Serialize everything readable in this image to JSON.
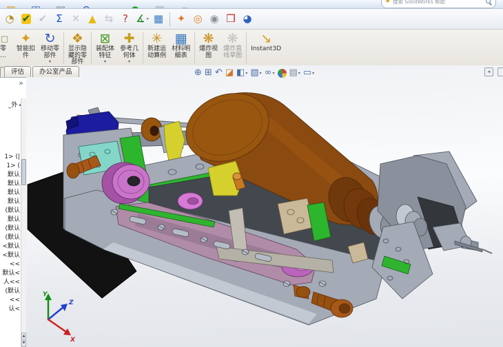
{
  "search": {
    "text": "搜索 SolidWorks 帮助",
    "flag_glyph": "⚑"
  },
  "quick_access": {
    "icons": [
      {
        "name": "open-file",
        "glyph": "▨",
        "color": "#d8a020"
      },
      {
        "name": "save",
        "glyph": "◫",
        "color": "#3060b0"
      },
      {
        "name": "print",
        "glyph": "▤",
        "color": "#708090"
      },
      {
        "name": "undo",
        "glyph": "↶",
        "color": "#3060b0"
      },
      {
        "name": "select",
        "glyph": "▭",
        "color": "#607080"
      },
      {
        "name": "rebuild",
        "glyph": "●",
        "color": "#20a020"
      },
      {
        "name": "file-properties",
        "glyph": "▣",
        "color": "#8898a8"
      },
      {
        "name": "toolbar-options",
        "glyph": "▾",
        "color": "#8898a8"
      }
    ]
  },
  "toolbar": {
    "icons": [
      {
        "name": "timer",
        "glyph": "◔",
        "color": "#b89020"
      },
      {
        "name": "design-checker",
        "glyph": "✔",
        "color": "#1a6a1a",
        "bg": "#f5c518"
      },
      {
        "name": "verification",
        "glyph": "✔",
        "color": "#8a9098",
        "disabled": true
      },
      {
        "name": "equations",
        "glyph": "Σ",
        "color": "#1a50c8"
      },
      {
        "name": "interference-detection",
        "glyph": "✕",
        "color": "#8a9098",
        "disabled": true
      },
      {
        "name": "draft-analysis",
        "glyph": "▲",
        "color": "#e8b810"
      },
      {
        "name": "symmetry-check",
        "glyph": "⇆",
        "color": "#8a9098",
        "disabled": true
      },
      {
        "name": "import-diagnostics",
        "glyph": "?",
        "color": "#c03030"
      },
      {
        "name": "measure",
        "glyph": "∡",
        "color": "#208020",
        "dropdown": true
      },
      {
        "name": "design-table",
        "glyph": "▦",
        "color": "#3878c0"
      },
      {
        "name": "separator"
      },
      {
        "name": "simulationxpress",
        "glyph": "✦",
        "color": "#e07820"
      },
      {
        "name": "floxpress",
        "glyph": "◎",
        "color": "#e08020"
      },
      {
        "name": "dfmxpress",
        "glyph": "◉",
        "color": "#8a9098"
      },
      {
        "name": "driveworksxpress",
        "glyph": "❒",
        "color": "#c02020"
      },
      {
        "name": "edrawings",
        "glyph": "◕",
        "color": "#3060c0"
      }
    ]
  },
  "ribbon": {
    "buttons": [
      {
        "name": "insert-component",
        "lines": [
          "零",
          "…"
        ],
        "clipped": true,
        "glyph": "▫",
        "color": "#b0a890"
      },
      {
        "name": "smart-fasteners",
        "lines": [
          "智能扣",
          "件"
        ],
        "glyph": "✦",
        "color": "#d4a017"
      },
      {
        "name": "move-component",
        "lines": [
          "移动零",
          "部件"
        ],
        "dropdown": true,
        "glyph": "↻",
        "color": "#3060c0",
        "sep_after": true
      },
      {
        "name": "show-hidden-components",
        "lines": [
          "显示隐",
          "藏的零",
          "部件"
        ],
        "dropdown": true,
        "glyph": "❖",
        "color": "#c89018",
        "sep_after": true
      },
      {
        "name": "assembly-features",
        "lines": [
          "装配体",
          "特征"
        ],
        "dropdown": true,
        "glyph": "⊠",
        "color": "#50a030"
      },
      {
        "name": "reference-geometry",
        "lines": [
          "参考几",
          "何体"
        ],
        "dropdown": true,
        "glyph": "✚",
        "color": "#c8a020",
        "sep_after": true
      },
      {
        "name": "new-motion-study",
        "lines": [
          "新建运",
          "动算例"
        ],
        "glyph": "✳",
        "color": "#c89018"
      },
      {
        "name": "bill-of-materials",
        "lines": [
          "材料明",
          "细表"
        ],
        "glyph": "▦",
        "color": "#3878c0",
        "sep_after": true
      },
      {
        "name": "exploded-view",
        "lines": [
          "爆炸视",
          "图"
        ],
        "glyph": "❋",
        "color": "#c89018"
      },
      {
        "name": "explode-line-sketch",
        "lines": [
          "爆炸直",
          "线草图"
        ],
        "disabled": true,
        "glyph": "❋",
        "color": "#909090",
        "sep_after": true
      },
      {
        "name": "instant3d",
        "lines": [
          "Instant3D"
        ],
        "glyph": "↘",
        "color": "#d4a017"
      }
    ]
  },
  "tabs": [
    {
      "name": "evaluate",
      "label": "评估"
    },
    {
      "name": "office-products",
      "label": "办公室产品"
    }
  ],
  "headsup": {
    "icons": [
      {
        "name": "zoom-to-fit",
        "glyph": "⊕",
        "color": "#4a6fa5"
      },
      {
        "name": "zoom-to-area",
        "glyph": "⊞",
        "color": "#4a6fa5"
      },
      {
        "name": "previous-view",
        "glyph": "↶",
        "color": "#4a6fa5"
      },
      {
        "name": "section-view",
        "glyph": "◪",
        "color": "#d07828"
      },
      {
        "name": "view-orientation",
        "glyph": "◧",
        "color": "#4a6fa5",
        "dropdown": true
      },
      {
        "name": "display-style",
        "glyph": "▧",
        "color": "#4a6fa5",
        "dropdown": true
      },
      {
        "name": "hide-show-items",
        "glyph": "∞",
        "color": "#4a6fa5",
        "dropdown": true
      },
      {
        "name": "edit-appearance",
        "ball": true
      },
      {
        "name": "apply-scene",
        "glyph": "▤",
        "color": "#7a88a0",
        "dropdown": true
      },
      {
        "name": "view-settings",
        "glyph": "▭",
        "color": "#4a6fa5",
        "dropdown": true
      }
    ]
  },
  "taskpane": {
    "collapse_glyph": "◂"
  },
  "sidebar": {
    "flyout_glyph": "»",
    "root_label": "_外",
    "root_caret": "▴",
    "items": [
      "1> (|",
      "1> (",
      "默认",
      "默认",
      "默认",
      "默认",
      "(默认",
      "默认",
      "(默认",
      "(默认",
      "<默认",
      "<默认",
      "<<",
      "默认<",
      "人<<",
      "(默认",
      "<<",
      "认<"
    ]
  },
  "triad": {
    "x_label": "X",
    "y_label": "Y",
    "z_label": "Z",
    "x_color": "#cc2020",
    "y_color": "#109010",
    "z_color": "#2040cc"
  },
  "model": {
    "description": "3D assembly of a dispensing/screw machine with brown motor cylinder, gray chassis, belt drive and needle",
    "palette": {
      "motor": "#8a4a10",
      "motor_cap": "#98560f",
      "motor_dark": "#6f390c",
      "motor_high": "#a35a14",
      "frame": "#a4aab6",
      "frame_light": "#c3c9d2",
      "frame_dark": "#8a909c",
      "edge": "#4d525b",
      "interior": "#43474e",
      "shadow": "#33373c",
      "black_part": "#121212",
      "blue_part": "#1c1ca0",
      "blue_dark": "#12127a",
      "teal_part": "#84d6c9",
      "green_part": "#2eb52e",
      "green_rail": "#30b430",
      "yellow_part": "#d6d02e",
      "magenta": "#c973c9",
      "magenta_dark": "#a452a4",
      "belt": "#b18ca9",
      "belt_dark": "#8e6f8c",
      "pink": "#d67ad6",
      "tan": "#c9b999",
      "brass": "#c87820",
      "brown_screw": "#a85818",
      "brown_dark": "#96500f"
    }
  }
}
